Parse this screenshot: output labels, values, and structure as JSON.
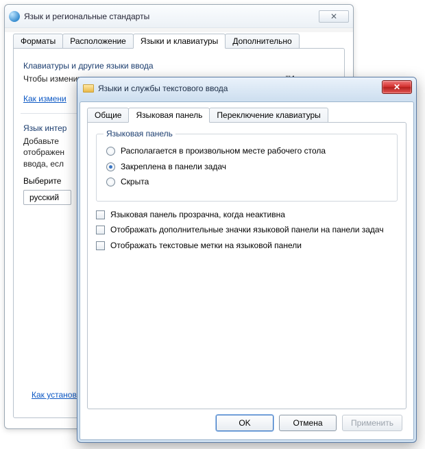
{
  "bg": {
    "title": "Язык и региональные стандарты",
    "close": "✕",
    "tabs": [
      "Форматы",
      "Расположение",
      "Языки и клавиатуры",
      "Дополнительно"
    ],
    "active_tab": 2,
    "group1": {
      "legend": "Клавиатуры и другие языки ввода",
      "text": "Чтобы изменить клавиатуру или язык ввода текста, нажмите кнопку \"Изменить",
      "link": "Как измени"
    },
    "group2": {
      "legend": "Язык интер",
      "text": "Добавьте\nотображен\nввода, есл",
      "select_label": "Выберите",
      "select_value": "русский"
    },
    "bottom_link": "Как установ"
  },
  "fg": {
    "title": "Языки и службы текстового ввода",
    "close": "✕",
    "tabs": [
      "Общие",
      "Языковая панель",
      "Переключение клавиатуры"
    ],
    "active_tab": 1,
    "groupbox_legend": "Языковая панель",
    "radios": [
      {
        "label": "Располагается в произвольном месте рабочего стола",
        "checked": false
      },
      {
        "label": "Закреплена в панели задач",
        "checked": true
      },
      {
        "label": "Скрыта",
        "checked": false
      }
    ],
    "checks": [
      {
        "label": "Языковая панель прозрачна, когда неактивна",
        "checked": false
      },
      {
        "label": "Отображать дополнительные значки языковой панели на панели задач",
        "checked": false
      },
      {
        "label": "Отображать текстовые метки на языковой панели",
        "checked": false
      }
    ],
    "buttons": {
      "ok": "OK",
      "cancel": "Отмена",
      "apply": "Применить"
    }
  }
}
